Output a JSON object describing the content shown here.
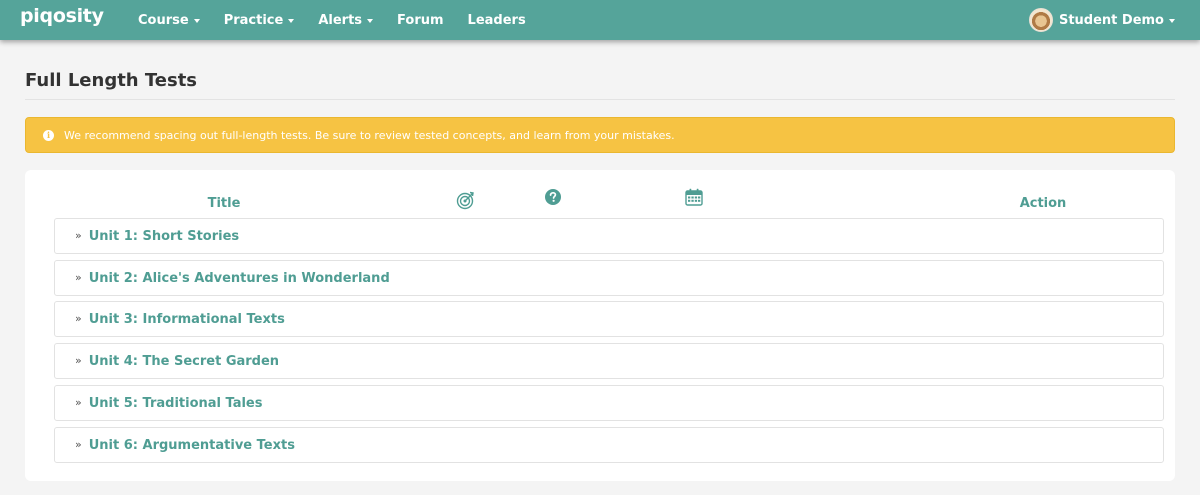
{
  "nav": {
    "brand": "piqosity",
    "items": [
      {
        "label": "Course",
        "dropdown": true
      },
      {
        "label": "Practice",
        "dropdown": true
      },
      {
        "label": "Alerts",
        "dropdown": true
      },
      {
        "label": "Forum",
        "dropdown": false
      },
      {
        "label": "Leaders",
        "dropdown": false
      }
    ],
    "user": {
      "name": "Student Demo"
    }
  },
  "page": {
    "title": "Full Length Tests",
    "alert": "We recommend spacing out full-length tests. Be sure to review tested concepts, and learn from your mistakes."
  },
  "table": {
    "headers": {
      "title": "Title",
      "target_icon": "target-icon",
      "help_icon": "question-circle-icon",
      "date_icon": "calendar-icon",
      "action": "Action"
    },
    "units": [
      "Unit 1: Short Stories",
      "Unit 2: Alice's Adventures in Wonderland",
      "Unit 3: Informational Texts",
      "Unit 4: The Secret Garden",
      "Unit 5: Traditional Tales",
      "Unit 6: Argumentative Texts"
    ]
  },
  "colors": {
    "nav": "#55a49a",
    "accent": "#4f9d93",
    "alert": "#f6c343"
  }
}
